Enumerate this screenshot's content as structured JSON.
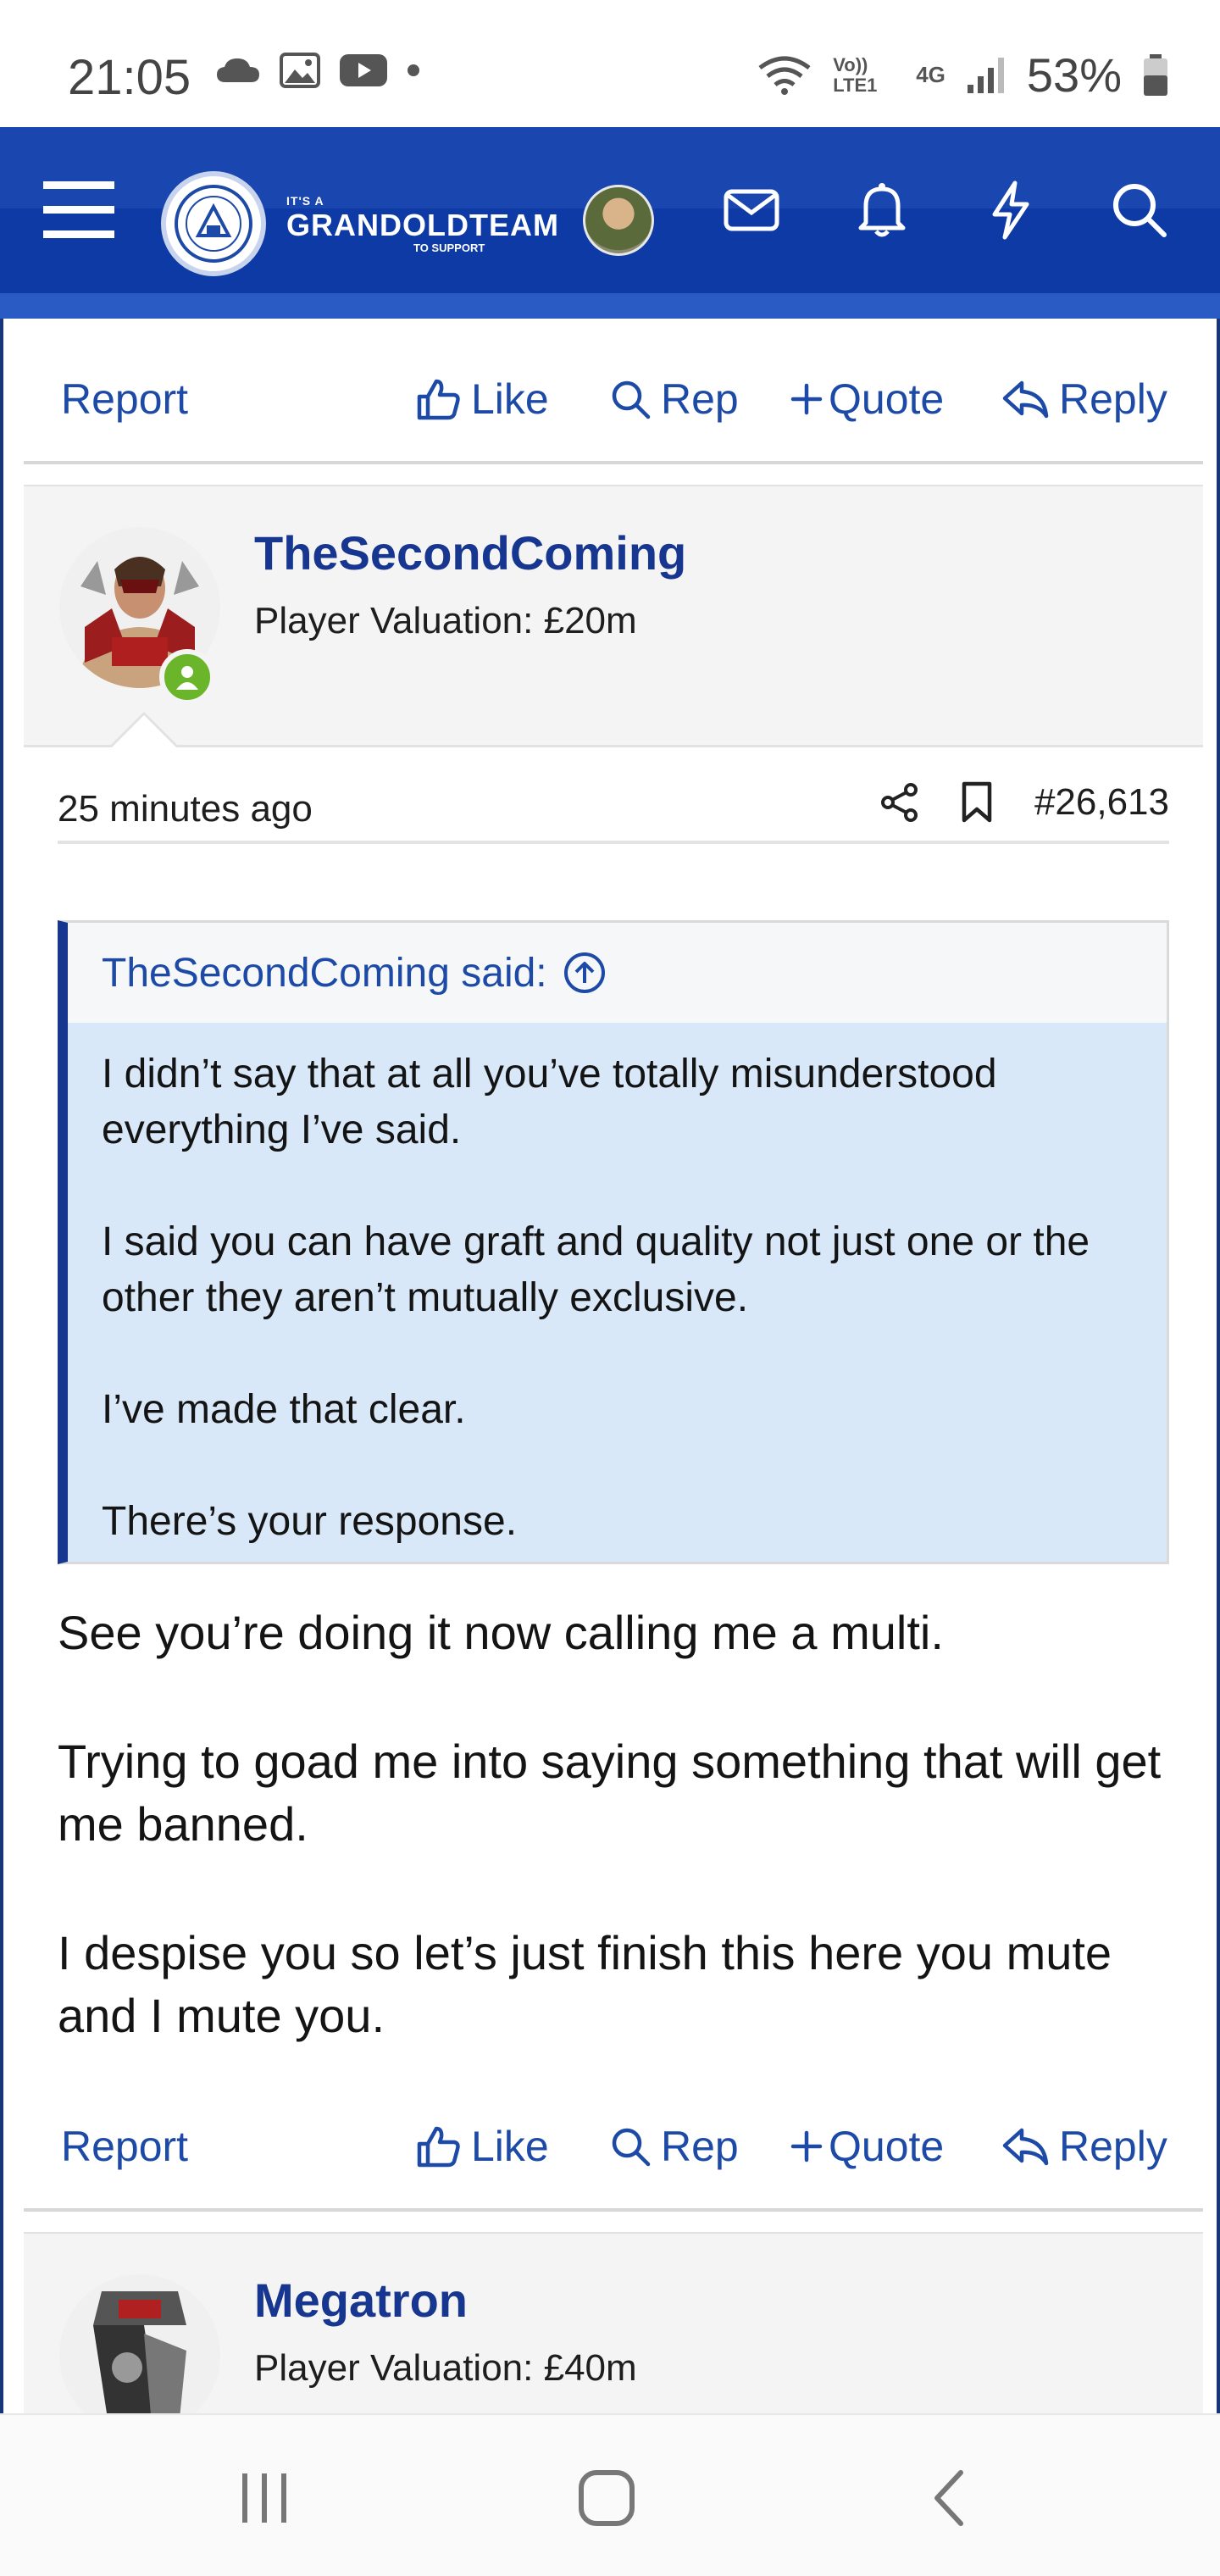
{
  "status_bar": {
    "time": "21:05",
    "battery": "53%",
    "network": "4G",
    "volte": "Vo)) LTE1"
  },
  "header": {
    "logo_top": "IT'S A",
    "logo_main": "GRANDOLDTEAM",
    "logo_sub": "TO SUPPORT",
    "icons": [
      "menu-icon",
      "envelope-icon",
      "bell-icon",
      "lightning-icon",
      "search-icon"
    ]
  },
  "actions": {
    "report": "Report",
    "like": "Like",
    "rep": "Rep",
    "quote": "Quote",
    "reply": "Reply"
  },
  "post": {
    "username": "TheSecondComing",
    "user_title": "Player Valuation: £20m",
    "time_ago": "25 minutes ago",
    "post_number": "#26,613",
    "quote_author": "TheSecondComing said:",
    "quote_paragraphs": [
      "I didn’t say that at all you’ve totally misunderstood everything I’ve said.",
      "I said you can have graft and quality not just one or the other they aren’t mutually exclusive.",
      "I’ve made that clear.",
      "There’s your response."
    ],
    "message_paragraphs": [
      "See you’re doing it now calling me a multi.",
      "Trying to goad me into saying something that will get me banned.",
      "I despise you so let’s just finish this here you mute and I mute you."
    ]
  },
  "next_post": {
    "username": "Megatron",
    "user_title": "Player Valuation: £40m"
  },
  "colors": {
    "header_blue": "#0d3aa4",
    "link_blue": "#1c4aa6",
    "username_blue": "#17368f",
    "quote_bg": "#d8e8f8",
    "online_green": "#6ab52a"
  }
}
